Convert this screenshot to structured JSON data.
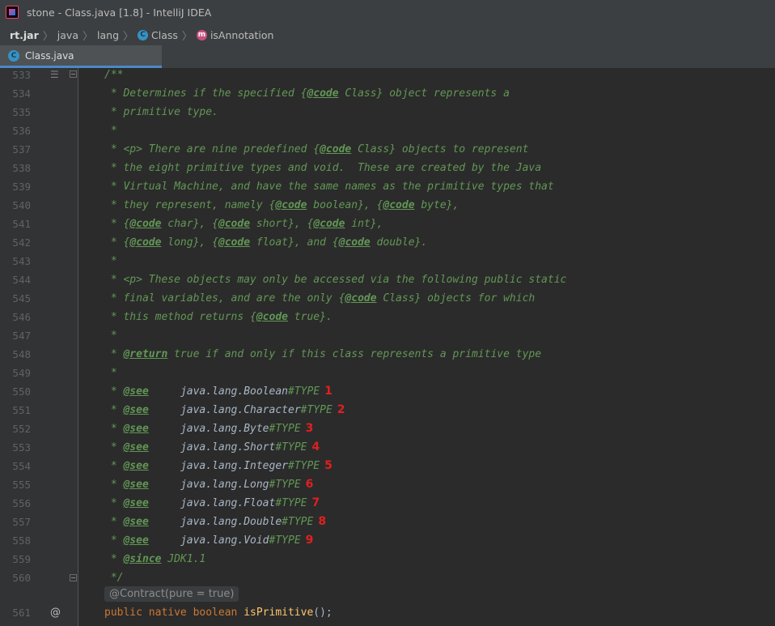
{
  "window": {
    "title": "stone - Class.java [1.8] - IntelliJ IDEA"
  },
  "breadcrumb": {
    "items": [
      "rt.jar",
      "java",
      "lang",
      "Class",
      "isAnnotation"
    ],
    "separator": "〉"
  },
  "tab": {
    "label": "Class.java"
  },
  "icons": {
    "class_letter": "C",
    "method_letter": "m"
  },
  "colors": {
    "comment": "#629755",
    "keyword": "#cc7832",
    "function": "#ffc66d",
    "annotation_red": "#e02020"
  },
  "editor": {
    "line_numbers": [
      "533",
      "534",
      "535",
      "536",
      "537",
      "538",
      "539",
      "540",
      "541",
      "542",
      "543",
      "544",
      "545",
      "546",
      "547",
      "548",
      "549",
      "550",
      "551",
      "552",
      "553",
      "554",
      "555",
      "556",
      "557",
      "558",
      "559",
      "560",
      "561"
    ],
    "annotation_hint": "@Contract(pure = true)",
    "at_marker": "@",
    "lines": {
      "l533": "/**",
      "l534a": " * Determines if the specified {",
      "l534tag": "@code",
      "l534b": " Class} object represents a",
      "l535": " * primitive type.",
      "l536": " *",
      "l537a": " * <p> There are nine predefined {",
      "l537tag": "@code",
      "l537b": " Class} objects to represent",
      "l538": " * the eight primitive types and void.  These are created by the Java",
      "l539": " * Virtual Machine, and have the same names as the primitive types that",
      "l540a": " * they represent, namely {",
      "l540tag1": "@code",
      "l540b": " boolean}, {",
      "l540tag2": "@code",
      "l540c": " byte},",
      "l541a": " * {",
      "l541tag1": "@code",
      "l541b": " char}, {",
      "l541tag2": "@code",
      "l541c": " short}, {",
      "l541tag3": "@code",
      "l541d": " int},",
      "l542a": " * {",
      "l542tag1": "@code",
      "l542b": " long}, {",
      "l542tag2": "@code",
      "l542c": " float}, and {",
      "l542tag3": "@code",
      "l542d": " double}.",
      "l543": " *",
      "l544": " * <p> These objects may only be accessed via the following public static",
      "l545a": " * final variables, and are the only {",
      "l545tag": "@code",
      "l545b": " Class} objects for which",
      "l546a": " * this method returns {",
      "l546tag": "@code",
      "l546b": " true}.",
      "l547": " *",
      "l548a": " * ",
      "l548tag": "@return",
      "l548b": " true if and only if this class represents a primitive type",
      "l549": " *",
      "see_prefix": " * ",
      "see_tag": "@see",
      "see_refs": [
        {
          "ref": "java.lang.Boolean",
          "suffix": "#TYPE",
          "mark": "1"
        },
        {
          "ref": "java.lang.Character",
          "suffix": "#TYPE",
          "mark": "2"
        },
        {
          "ref": "java.lang.Byte",
          "suffix": "#TYPE",
          "mark": "3"
        },
        {
          "ref": "java.lang.Short",
          "suffix": "#TYPE",
          "mark": "4"
        },
        {
          "ref": "java.lang.Integer",
          "suffix": "#TYPE",
          "mark": "5"
        },
        {
          "ref": "java.lang.Long",
          "suffix": "#TYPE",
          "mark": "6"
        },
        {
          "ref": "java.lang.Float",
          "suffix": "#TYPE",
          "mark": "7"
        },
        {
          "ref": "java.lang.Double",
          "suffix": "#TYPE",
          "mark": "8"
        },
        {
          "ref": "java.lang.Void",
          "suffix": "#TYPE",
          "mark": "9"
        }
      ],
      "l559a": " * ",
      "l559tag": "@since",
      "l559b": " JDK1.1",
      "l560": " */",
      "l561_kw": "public native boolean ",
      "l561_fn": "isPrimitive",
      "l561_end": "();"
    }
  }
}
